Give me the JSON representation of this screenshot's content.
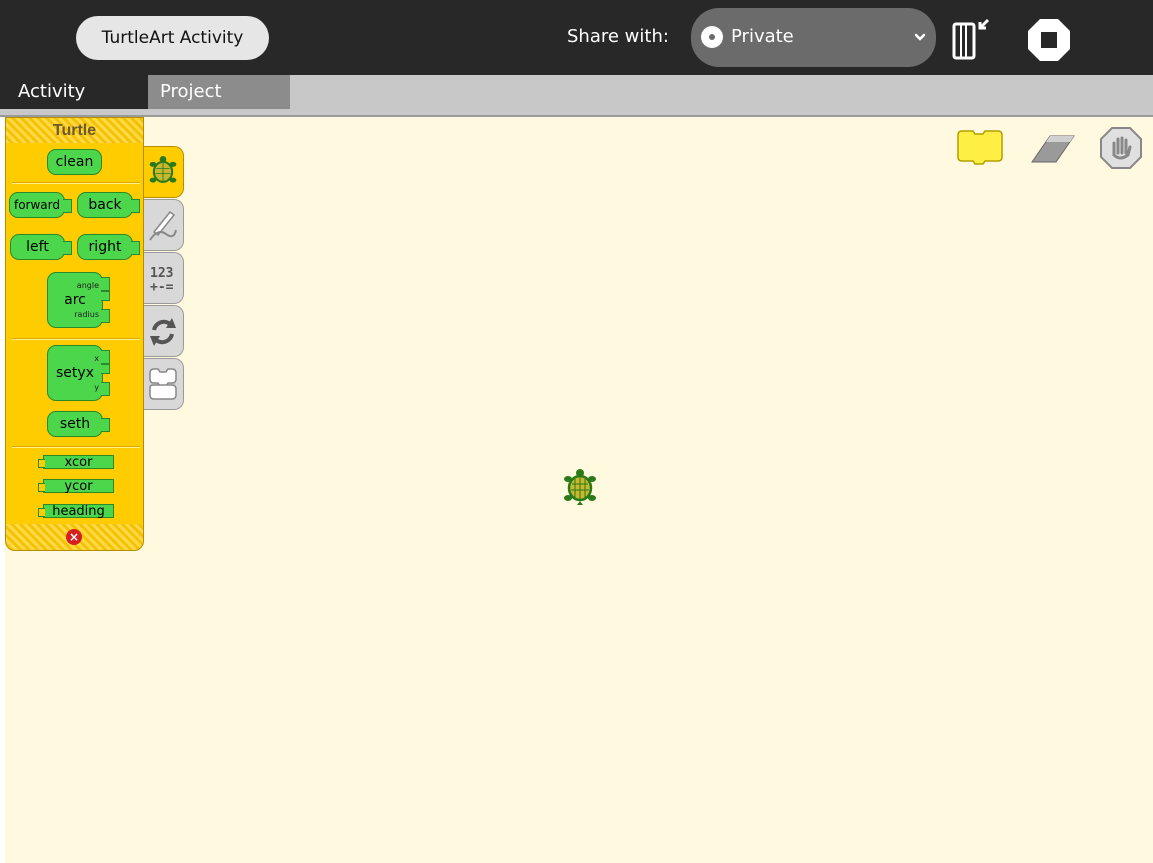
{
  "toolbar": {
    "activity_title": "TurtleArt Activity",
    "share_label": "Share with:",
    "share_value": "Private",
    "keep_icon": "keep-journal-icon",
    "stop_icon": "stop-icon"
  },
  "tabs": [
    {
      "label": "Activity"
    },
    {
      "label": "Project"
    }
  ],
  "palette": {
    "title": "Turtle",
    "blocks": {
      "clean": "clean",
      "forward": "forward",
      "back": "back",
      "left": "left",
      "right": "right",
      "arc": "arc",
      "arc_angle": "angle",
      "arc_radius": "radius",
      "setxy": "setyx",
      "setxy_x": "x",
      "setxy_y": "y",
      "seth": "seth",
      "xcor": "xcor",
      "ycor": "ycor",
      "heading": "heading"
    },
    "categories": [
      "turtle",
      "pen",
      "numbers",
      "flow",
      "blocks"
    ],
    "category_icons": [
      "turtle-icon",
      "pen-icon",
      "numbers-icon",
      "flow-icon",
      "blocks-icon"
    ]
  },
  "canvas_tools": [
    "show-blocks-icon",
    "eraser-icon",
    "stop-turtle-icon"
  ],
  "colors": {
    "toolbar": "#282828",
    "palette": "#ffcc00",
    "block": "#4cd64c",
    "canvas": "#fff9e0"
  }
}
